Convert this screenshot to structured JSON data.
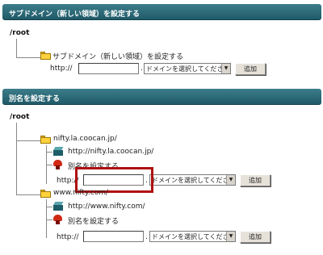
{
  "section1": {
    "title": "サブドメイン（新しい領域）を設定する",
    "root": "/root",
    "folder_label": "サブドメイン（新しい領域）を設定する",
    "prefix": "http://",
    "dot": ".",
    "select_value": "ドメインを選択してください",
    "add_button": "追加"
  },
  "section2": {
    "title": "別名を設定する",
    "root": "/root",
    "entries": [
      {
        "domain": "nifty.la.coocan.jp/",
        "url": "http://nifty.la.coocan.jp/",
        "alias_label": "別名を設定する",
        "prefix": "http://",
        "dot": ".",
        "select_value": "ドメインを選択してください",
        "add_button": "追加"
      },
      {
        "domain": "www.nifty.com/",
        "url": "http://www.nifty.com/",
        "alias_label": "別名を設定する",
        "prefix": "http://",
        "dot": ".",
        "select_value": "ドメインを選択してください",
        "add_button": "追加"
      }
    ]
  },
  "colors": {
    "header_bar": "#2c6b78",
    "highlight": "#b01010"
  }
}
